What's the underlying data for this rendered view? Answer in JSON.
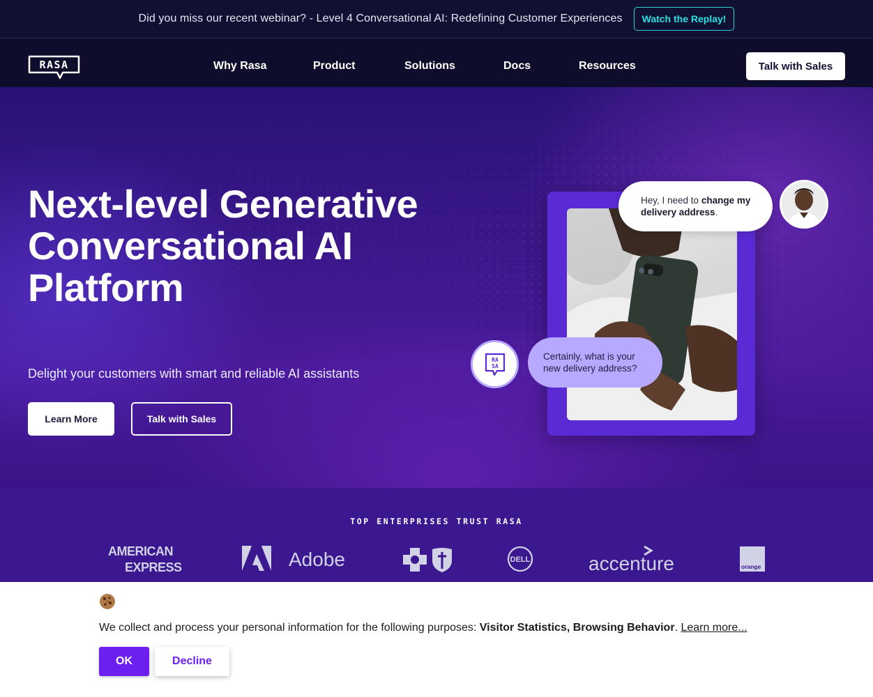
{
  "announcement": {
    "text": "Did you miss our recent webinar? - Level 4 Conversational AI: Redefining Customer Experiences",
    "cta": "Watch the Replay!"
  },
  "nav": {
    "logo": "RASA",
    "items": [
      "Why Rasa",
      "Product",
      "Solutions",
      "Docs",
      "Resources"
    ],
    "cta": "Talk with Sales"
  },
  "hero": {
    "headline": "Next-level Generative Conversational AI Platform",
    "subheadline": "Delight your customers with smart and reliable AI assistants",
    "primary_cta": "Learn More",
    "secondary_cta": "Talk with Sales",
    "user_message_prefix": "Hey, I need to ",
    "user_message_bold": "change my delivery address",
    "user_message_suffix": ".",
    "bot_message": "Certainly, what is your new delivery address?",
    "bot_logo_text": "RA SA"
  },
  "trust": {
    "title": "TOP ENTERPRISES TRUST RASA",
    "logos": [
      "AMERICAN EXPRESS",
      "Adobe",
      "BlueCross BlueShield",
      "DELL",
      "accenture",
      "orange"
    ]
  },
  "cookie_banner": {
    "text_prefix": "We collect and process your personal information for the following purposes: ",
    "purposes": "Visitor Statistics, Browsing Behavior",
    "text_suffix": ". ",
    "learn_more": "Learn more...",
    "ok": "OK",
    "decline": "Decline"
  },
  "colors": {
    "accent_cyan": "#2fe0e0",
    "accent_purple": "#6c1ff0",
    "nav_bg": "#0e0e2c",
    "hero_purple": "#3b1890"
  }
}
